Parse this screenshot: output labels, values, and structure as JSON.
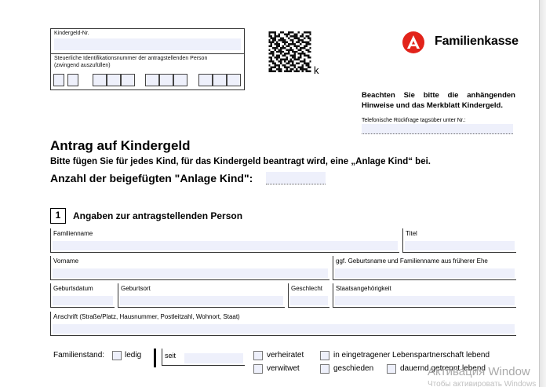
{
  "header": {
    "kindergeld_nr_label": "Kindergeld-Nr.",
    "steuer_id_label_1": "Steuerliche Identifikationsnummer der antragstellenden Person",
    "steuer_id_label_2": "(zwingend auszufüllen)",
    "qr_suffix": "k",
    "brand": "Familienkasse",
    "note": "Beachten Sie bitte die anhängenden Hinweise und das Merkblatt Kindergeld.",
    "phone_label": "Telefonische Rückfrage tagsüber unter Nr.:"
  },
  "form": {
    "title": "Antrag auf Kindergeld",
    "subtitle": "Bitte fügen Sie für jedes Kind, für das Kindergeld beantragt wird, eine „Anlage Kind“ bei.",
    "count_label": "Anzahl der beigefügten \"Anlage Kind\":"
  },
  "section1": {
    "number": "1",
    "title": "Angaben zur antragstellenden Person",
    "fields": {
      "familienname": "Familienname",
      "titel": "Titel",
      "vorname": "Vorname",
      "geburtsname": "ggf. Geburtsname und Familienname aus früherer Ehe",
      "geburtsdatum": "Geburtsdatum",
      "geburtsort": "Geburtsort",
      "geschlecht": "Geschlecht",
      "staatsangehoerigkeit": "Staatsangehörigkeit",
      "anschrift": "Anschrift (Straße/Platz, Hausnummer, Postleitzahl, Wohnort, Staat)"
    },
    "familienstand": {
      "label": "Familienstand:",
      "ledig": "ledig",
      "seit": "seit",
      "verheiratet": "verheiratet",
      "verwitwet": "verwitwet",
      "lebenspartnerschaft": "in eingetragener Lebenspartnerschaft lebend",
      "geschieden": "geschieden",
      "getrennt": "dauernd getrennt lebend"
    }
  },
  "overlay": {
    "watermark_line1": "Активация Window",
    "watermark_line2": "Чтобы активировать Windows"
  },
  "colors": {
    "field_fill": "#eef0fb",
    "brand_red": "#e2231a"
  }
}
